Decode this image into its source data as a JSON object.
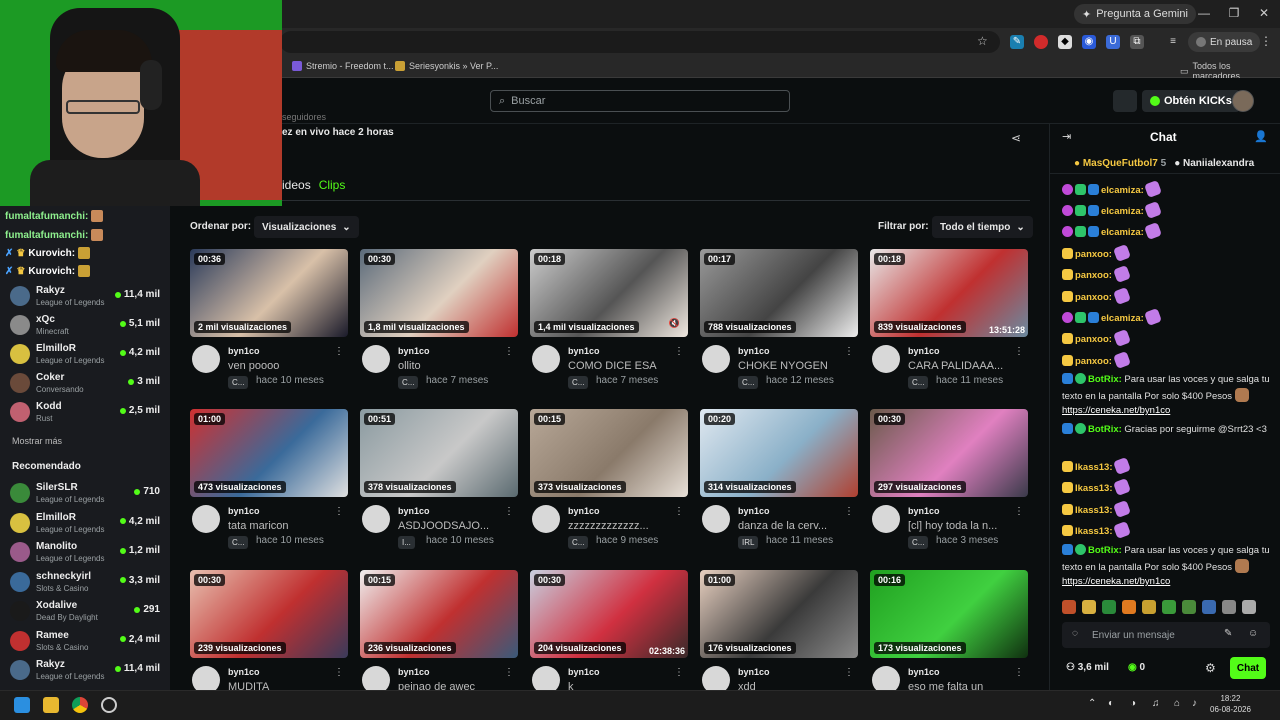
{
  "browser": {
    "gemini_label": "Pregunta a Gemini",
    "paused_label": "En pausa",
    "bookmarks": [
      "Stremio - Freedom t...",
      "Seriesyonkis » Ver P..."
    ],
    "all_bookmarks_label": "Todos los marcadores"
  },
  "kick": {
    "search_placeholder": "Buscar",
    "kicks_button": "Obtén KICKs"
  },
  "channel": {
    "followers_text": "seguidores",
    "last_live": "ez en vivo hace 2 horas",
    "tab_videos": "ideos",
    "tab_clips": "Clips"
  },
  "filters": {
    "sort_label": "Ordenar por:",
    "sort_value": "Visualizaciones",
    "filter_label": "Filtrar por:",
    "filter_value": "Todo el tiempo"
  },
  "clips": [
    {
      "duration": "00:36",
      "views": "2 mil visualizaciones",
      "user": "byn1co",
      "title": "ven poooo",
      "tag": "C...",
      "date": "hace 10 meses"
    },
    {
      "duration": "00:30",
      "views": "1,8 mil visualizaciones",
      "user": "byn1co",
      "title": "ollito",
      "tag": "C...",
      "date": "hace 7 meses"
    },
    {
      "duration": "00:18",
      "views": "1,4 mil visualizaciones",
      "user": "byn1co",
      "title": "COMO DICE ESA",
      "tag": "C...",
      "date": "hace 7 meses"
    },
    {
      "duration": "00:17",
      "views": "788 visualizaciones",
      "user": "byn1co",
      "title": "CHOKE NYOGEN",
      "tag": "C...",
      "date": "hace 12 meses"
    },
    {
      "duration": "00:18",
      "views": "839 visualizaciones",
      "user": "byn1co",
      "title": "CARA PALIDAAA...",
      "tag": "C...",
      "date": "hace 11 meses",
      "overlay": "13:51:28"
    },
    {
      "duration": "01:00",
      "views": "473 visualizaciones",
      "user": "byn1co",
      "title": "tata maricon",
      "tag": "C...",
      "date": "hace 10 meses"
    },
    {
      "duration": "00:51",
      "views": "378 visualizaciones",
      "user": "byn1co",
      "title": "ASDJOODSAJO...",
      "tag": "I...",
      "date": "hace 10 meses"
    },
    {
      "duration": "00:15",
      "views": "373 visualizaciones",
      "user": "byn1co",
      "title": "zzzzzzzzzzzzz...",
      "tag": "C...",
      "date": "hace 9 meses"
    },
    {
      "duration": "00:20",
      "views": "314 visualizaciones",
      "user": "byn1co",
      "title": "danza de la cerv...",
      "tag": "IRL",
      "date": "hace 11 meses"
    },
    {
      "duration": "00:30",
      "views": "297 visualizaciones",
      "user": "byn1co",
      "title": "[cl] hoy toda la n...",
      "tag": "C...",
      "date": "hace 3 meses"
    },
    {
      "duration": "00:30",
      "views": "239 visualizaciones",
      "user": "byn1co",
      "title": "MUDITA",
      "tag": "",
      "date": ""
    },
    {
      "duration": "00:15",
      "views": "236 visualizaciones",
      "user": "byn1co",
      "title": "peinao de awec",
      "tag": "",
      "date": ""
    },
    {
      "duration": "00:30",
      "views": "204 visualizaciones",
      "user": "byn1co",
      "title": "k",
      "tag": "",
      "date": "",
      "overlay": "02:38:36"
    },
    {
      "duration": "01:00",
      "views": "176 visualizaciones",
      "user": "byn1co",
      "title": "xdd",
      "tag": "",
      "date": ""
    },
    {
      "duration": "00:16",
      "views": "173 visualizaciones",
      "user": "byn1co",
      "title": "eso me falta un",
      "tag": "",
      "date": ""
    }
  ],
  "sidebar": {
    "overlay_chat": [
      {
        "name": "fumaltafumanchi:"
      },
      {
        "name": "fumaltafumanchi:"
      },
      {
        "name": "Kurovich:"
      },
      {
        "name": "Kurovich:"
      }
    ],
    "following": [
      {
        "name": "Rakyz",
        "category": "League of Legends",
        "viewers": "11,4 mil"
      },
      {
        "name": "xQc",
        "category": "Minecraft",
        "viewers": "5,1 mil"
      },
      {
        "name": "ElmilloR",
        "category": "League of Legends",
        "viewers": "4,2 mil"
      },
      {
        "name": "Coker",
        "category": "Conversando",
        "viewers": "3 mil"
      },
      {
        "name": "Kodd",
        "category": "Rust",
        "viewers": "2,5 mil"
      }
    ],
    "show_more": "Mostrar más",
    "recommended_title": "Recomendado",
    "recommended": [
      {
        "name": "SilerSLR",
        "category": "League of Legends",
        "viewers": "710"
      },
      {
        "name": "ElmilloR",
        "category": "League of Legends",
        "viewers": "4,2 mil"
      },
      {
        "name": "Manolito",
        "category": "League of Legends",
        "viewers": "1,2 mil"
      },
      {
        "name": "schneckyirl",
        "category": "Slots & Casino",
        "viewers": "3,3 mil"
      },
      {
        "name": "Xodalive",
        "category": "Dead By Daylight",
        "viewers": "291"
      },
      {
        "name": "Ramee",
        "category": "Slots & Casino",
        "viewers": "2,4 mil"
      },
      {
        "name": "Rakyz",
        "category": "League of Legends",
        "viewers": "11,4 mil"
      }
    ]
  },
  "chat": {
    "title": "Chat",
    "pinned": [
      "MasQueFutbol7",
      "5",
      "Naniialexandra"
    ],
    "messages": [
      {
        "user": "elcamiza:",
        "color": "#f5c842"
      },
      {
        "user": "elcamiza:",
        "color": "#f5c842"
      },
      {
        "user": "elcamiza:",
        "color": "#f5c842"
      },
      {
        "user": "panxoo:",
        "color": "#f5c842"
      },
      {
        "user": "panxoo:",
        "color": "#f5c842"
      },
      {
        "user": "panxoo:",
        "color": "#f5c842"
      },
      {
        "user": "elcamiza:",
        "color": "#f5c842"
      },
      {
        "user": "panxoo:",
        "color": "#f5c842"
      },
      {
        "user": "panxoo:",
        "color": "#f5c842"
      }
    ],
    "botrix1_user": "BotRix:",
    "botrix1_text": "Para usar las voces y que salga tu texto en la pantalla Por solo $400 Pesos",
    "botrix_link": "https://ceneka.net/byn1co",
    "botrix2_user": "BotRix:",
    "botrix2_text": "Gracias por seguirme @Srrt23 <3",
    "ikass": [
      "Ikass13:",
      "Ikass13:",
      "Ikass13:",
      "Ikass13:"
    ],
    "botrix3_user": "BotRix:",
    "botrix3_text": "Para usar las voces y que salga tu texto en la pantalla Por solo $400 Pesos",
    "input_placeholder": "Enviar un mensaje",
    "viewer_count": "3,6 mil",
    "kicks_count": "0",
    "send_label": "Chat"
  },
  "taskbar": {
    "time": "18:22",
    "date": "06-08-2026"
  }
}
